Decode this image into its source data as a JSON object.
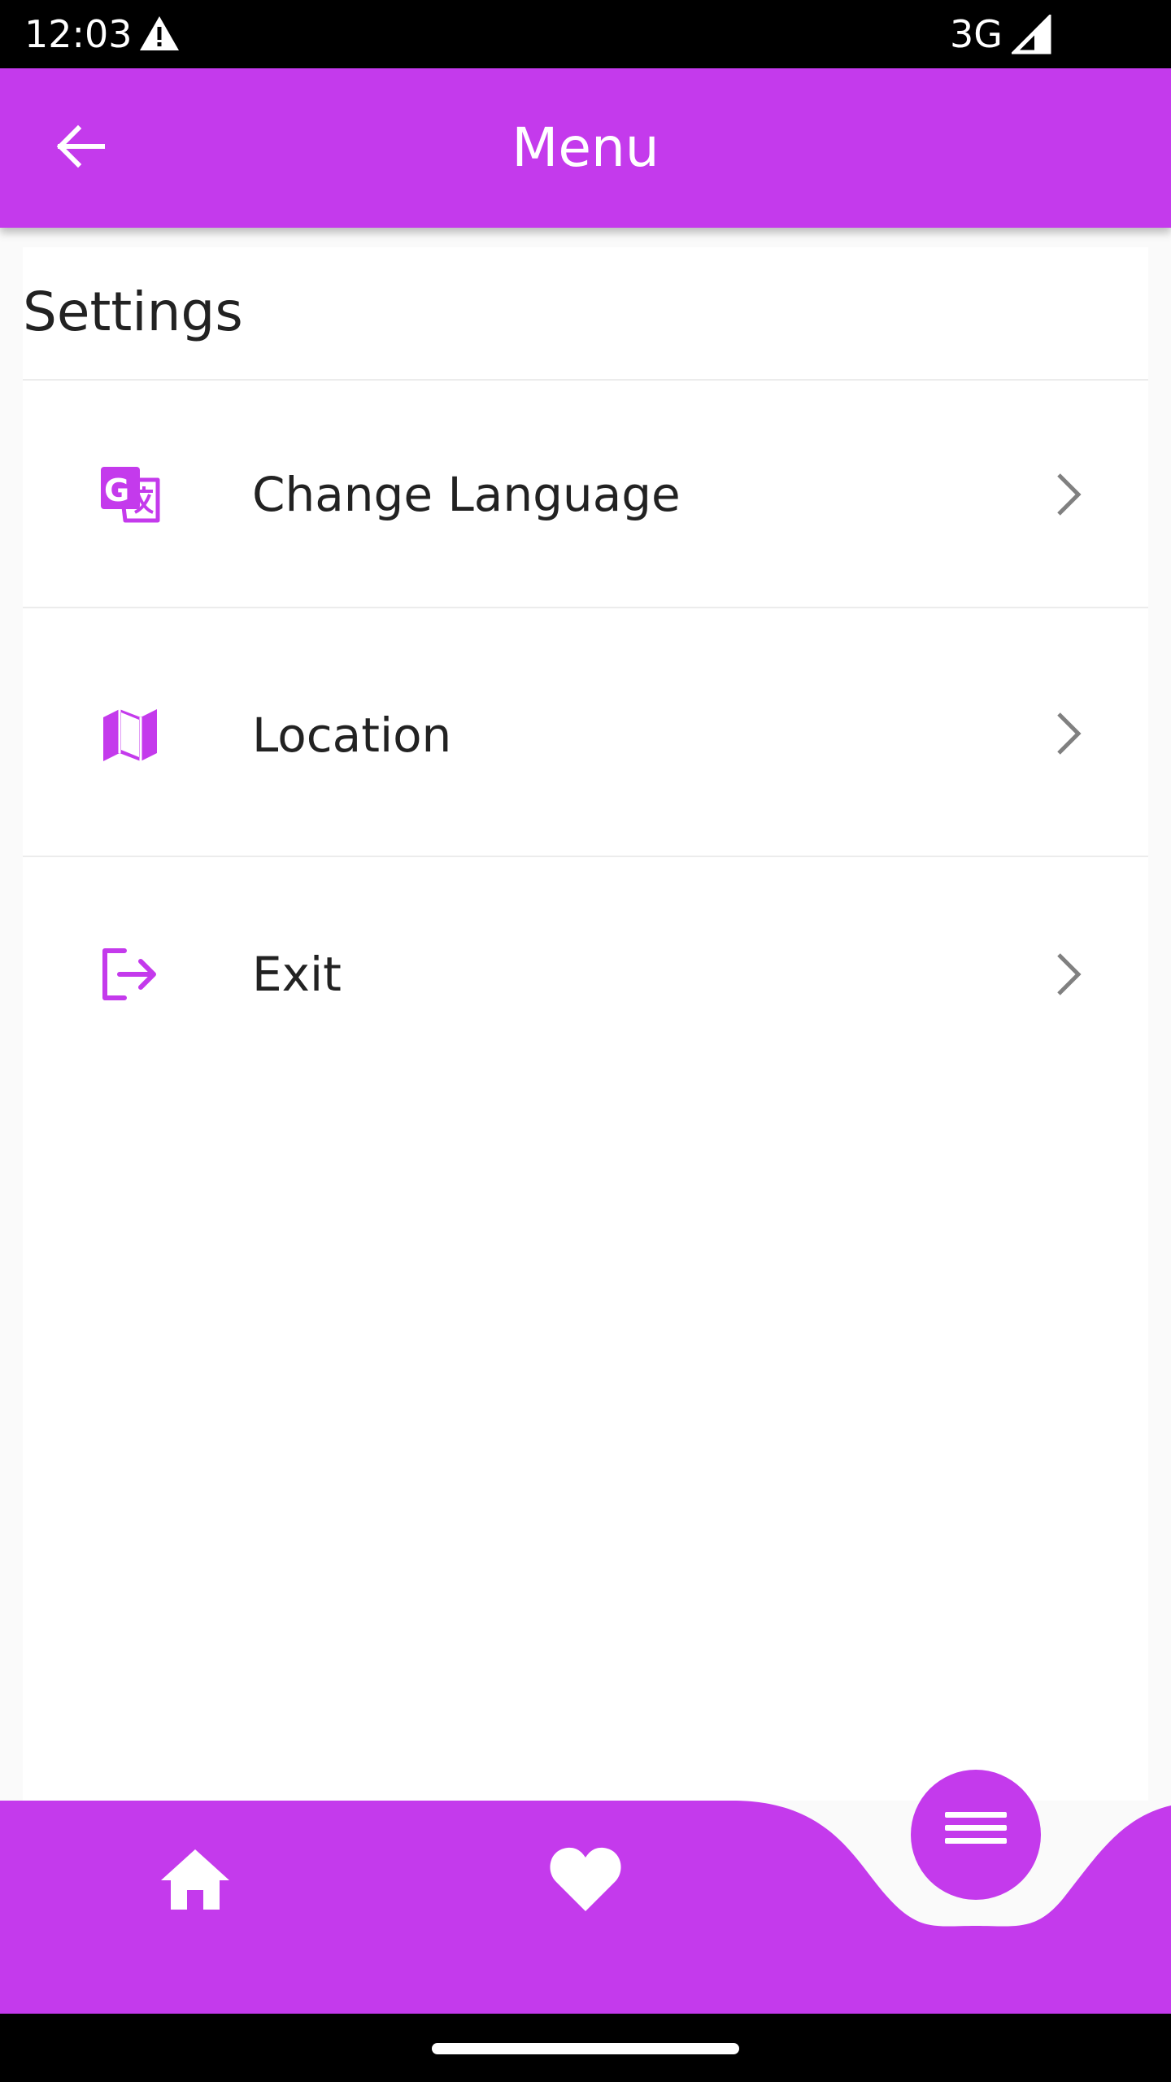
{
  "status_bar": {
    "time": "12:03",
    "network": "3G",
    "warning_icon": "warning-icon",
    "signal_icon": "signal-icon"
  },
  "app_bar": {
    "title": "Menu",
    "back_icon": "arrow-back-icon"
  },
  "settings": {
    "section_title": "Settings",
    "items": [
      {
        "label": "Change Language",
        "icon": "translate-icon"
      },
      {
        "label": "Location",
        "icon": "map-icon"
      },
      {
        "label": "Exit",
        "icon": "logout-icon"
      }
    ]
  },
  "bottom_nav": {
    "items": [
      {
        "icon": "home-icon"
      },
      {
        "icon": "heart-icon"
      },
      {
        "icon": "menu-icon",
        "active": true
      }
    ]
  },
  "colors": {
    "accent": "#c43aec",
    "status_bar": "#000000",
    "text": "#222222",
    "chevron": "#808080"
  }
}
